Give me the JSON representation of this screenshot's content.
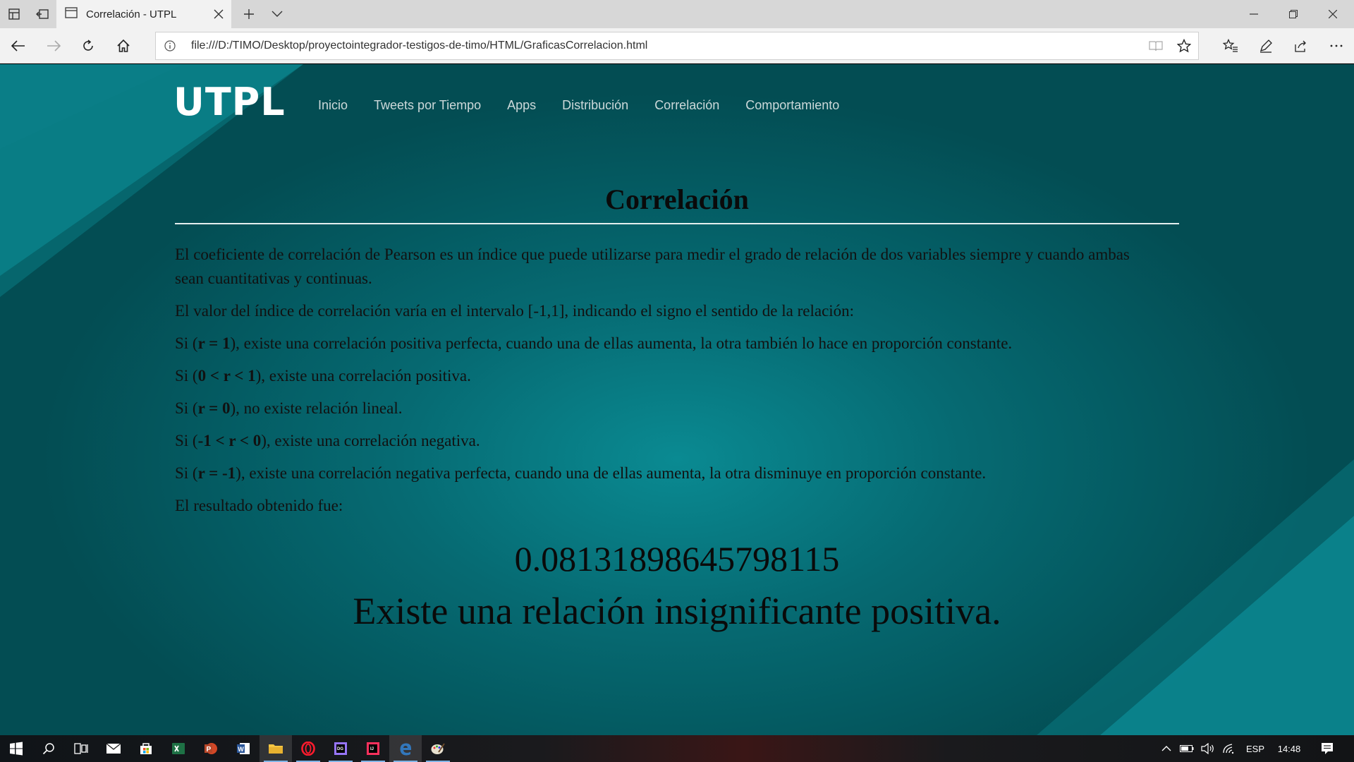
{
  "browser": {
    "tab_title": "Correlación - UTPL",
    "url": "file:///D:/TIMO/Desktop/proyectointegrador-testigos-de-timo/HTML/GraficasCorrelacion.html"
  },
  "site": {
    "brand": "UTPL",
    "menu": [
      "Inicio",
      "Tweets por Tiempo",
      "Apps",
      "Distribución",
      "Correlación",
      "Comportamiento"
    ]
  },
  "content": {
    "title": "Correlación",
    "p1": "El coeficiente de correlación de Pearson es un índice que puede utilizarse para medir el grado de relación de dos variables siempre y cuando ambas sean cuantitativas y continuas.",
    "p2": "El valor del índice de correlación varía en el intervalo [-1,1], indicando el signo el sentido de la relación:",
    "rules": [
      {
        "pre": "Si (",
        "bold": "r = 1",
        "post": "), existe una correlación positiva perfecta, cuando una de ellas aumenta, la otra también lo hace en proporción constante."
      },
      {
        "pre": "Si (",
        "bold": "0 < r < 1",
        "post": "), existe una correlación positiva."
      },
      {
        "pre": "Si (",
        "bold": "r = 0",
        "post": "), no existe relación lineal."
      },
      {
        "pre": "Si (",
        "bold": "-1 < r < 0",
        "post": "), existe una correlación negativa."
      },
      {
        "pre": "Si (",
        "bold": "r = -1",
        "post": "), existe una correlación negativa perfecta, cuando una de ellas aumenta, la otra disminuye en proporción constante."
      }
    ],
    "result_label": "El resultado obtenido fue:",
    "result_value": "0.08131898645798115",
    "verdict": "Existe una relación insignificante positiva."
  },
  "taskbar": {
    "apps": [
      "start-icon",
      "search-icon",
      "task-view-icon",
      "mail-icon",
      "store-icon",
      "excel-icon",
      "powerpoint-icon",
      "word-icon",
      "file-explorer-icon",
      "opera-icon",
      "datagrip-icon",
      "intellij-icon",
      "edge-icon",
      "paint-icon"
    ],
    "language": "ESP",
    "time": "14:48"
  },
  "colors": {
    "page_bg": "#066a72",
    "accent_stripe": "#0d8f98"
  }
}
